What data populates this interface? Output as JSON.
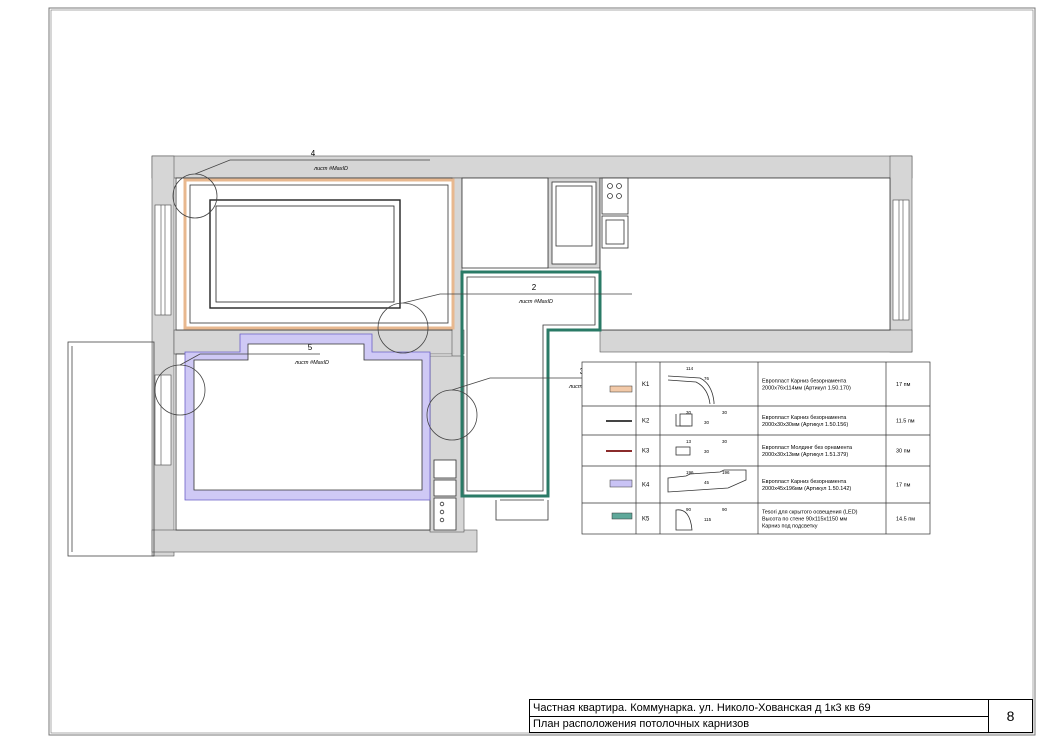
{
  "plan": {
    "labels": [
      {
        "id": "4",
        "ref": "лист #MaxID"
      },
      {
        "id": "2",
        "ref": "лист #MaxID"
      },
      {
        "id": "5",
        "ref": "лист #MaxID"
      },
      {
        "id": "3",
        "ref": "лист #MaxID"
      }
    ]
  },
  "legend": {
    "rows": [
      {
        "code": "K1",
        "color": "#f2c9a8",
        "desc_lines": [
          "Европласт Карниз безорнамента",
          "2000x76x114мм (Артикул 1.50.170)"
        ],
        "qty": "17 пм",
        "dims": [
          "114",
          "76"
        ]
      },
      {
        "code": "K2",
        "color": "#444444",
        "desc_lines": [
          "Европласт Карниз безорнамента",
          "2000x30x30мм (Артикул 1.50.156)"
        ],
        "qty": "11.5 пм",
        "dims": [
          "30",
          "30",
          "30"
        ]
      },
      {
        "code": "K3",
        "color": "#8a2b2b",
        "desc_lines": [
          "Европласт Молдинг без орнамента",
          "2000x30x13мм (Артикул 1.51.379)"
        ],
        "qty": "30 пм",
        "dims": [
          "13",
          "30",
          "30"
        ]
      },
      {
        "code": "K4",
        "color": "#c9c3f5",
        "desc_lines": [
          "Европласт Карниз безорнамента",
          "2000x45x196мм (Артикул 1.50.142)"
        ],
        "qty": "17 пм",
        "dims": [
          "196",
          "45",
          "196"
        ]
      },
      {
        "code": "K5",
        "color": "#5fa89a",
        "desc_lines": [
          "Tesori для скрытого освещения (LED)",
          "Высота по стене    90x115x1150 мм",
          "Карниз под подсветку"
        ],
        "qty": "14.5 пм",
        "dims": [
          "90",
          "115",
          "90"
        ]
      }
    ]
  },
  "title_block": {
    "line1": "Частная квартира. Коммунарка. ул. Николо-Хованская д 1к3 кв 69",
    "line2": "План расположения потолочных карнизов",
    "sheet_number": "8"
  }
}
